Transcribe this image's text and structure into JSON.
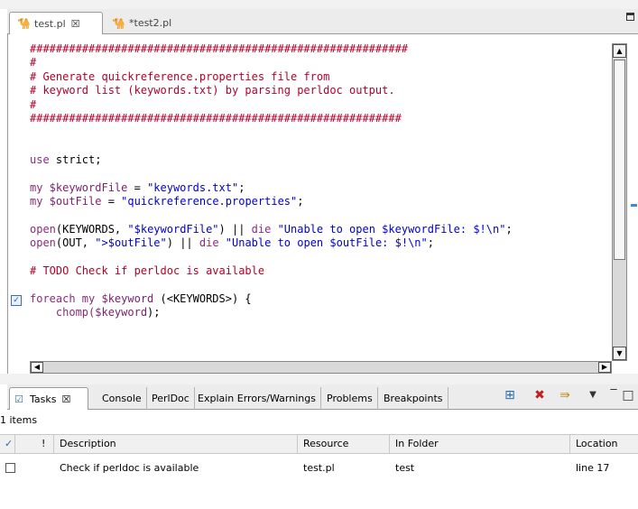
{
  "editor": {
    "tabs": [
      {
        "label": "test.pl",
        "close": "☒",
        "icon": "camel-icon"
      },
      {
        "label": "*test2.pl",
        "icon": "camel-icon"
      }
    ],
    "code_lines": [
      [
        {
          "t": "##########################################################",
          "c": "c-comment"
        }
      ],
      [
        {
          "t": "#",
          "c": "c-comment"
        }
      ],
      [
        {
          "t": "# Generate quickreference.properties file from",
          "c": "c-comment"
        }
      ],
      [
        {
          "t": "# keyword list (keywords.txt) by parsing perldoc output.",
          "c": "c-comment"
        }
      ],
      [
        {
          "t": "#",
          "c": "c-comment"
        }
      ],
      [
        {
          "t": "#########################################################",
          "c": "c-comment"
        }
      ],
      [],
      [],
      [
        {
          "t": "use",
          "c": "c-kw"
        },
        {
          "t": " strict;",
          "c": "c-plain"
        }
      ],
      [],
      [
        {
          "t": "my",
          "c": "c-kw"
        },
        {
          "t": " $keywordFile",
          "c": "c-var"
        },
        {
          "t": " = ",
          "c": "c-plain"
        },
        {
          "t": "\"keywords.txt\"",
          "c": "c-str"
        },
        {
          "t": ";",
          "c": "c-plain"
        }
      ],
      [
        {
          "t": "my",
          "c": "c-kw"
        },
        {
          "t": " $outFile",
          "c": "c-var"
        },
        {
          "t": " = ",
          "c": "c-plain"
        },
        {
          "t": "\"quickreference.properties\"",
          "c": "c-str"
        },
        {
          "t": ";",
          "c": "c-plain"
        }
      ],
      [],
      [
        {
          "t": "open",
          "c": "c-kw"
        },
        {
          "t": "(KEYWORDS, ",
          "c": "c-plain"
        },
        {
          "t": "\"$keywordFile\"",
          "c": "c-str"
        },
        {
          "t": ") || ",
          "c": "c-plain"
        },
        {
          "t": "die",
          "c": "c-kw"
        },
        {
          "t": " \"Unable to open $keywordFile: $!\\n\"",
          "c": "c-str"
        },
        {
          "t": ";",
          "c": "c-plain"
        }
      ],
      [
        {
          "t": "open",
          "c": "c-kw"
        },
        {
          "t": "(OUT, ",
          "c": "c-plain"
        },
        {
          "t": "\">$outFile\"",
          "c": "c-str"
        },
        {
          "t": ") || ",
          "c": "c-plain"
        },
        {
          "t": "die",
          "c": "c-kw"
        },
        {
          "t": " \"Unable to open $outFile: $!\\n\"",
          "c": "c-str"
        },
        {
          "t": ";",
          "c": "c-plain"
        }
      ],
      [],
      [
        {
          "t": "# TODO Check if perldoc is available",
          "c": "c-comment"
        }
      ],
      [],
      [
        {
          "t": "foreach",
          "c": "c-kw"
        },
        {
          "t": " my ",
          "c": "c-kw"
        },
        {
          "t": "$keyword",
          "c": "c-var"
        },
        {
          "t": " (<KEYWORDS>) {",
          "c": "c-plain"
        }
      ],
      [
        {
          "t": "    chomp(",
          "c": "c-kw"
        },
        {
          "t": "$keyword",
          "c": "c-var"
        },
        {
          "t": ");",
          "c": "c-plain"
        }
      ]
    ]
  },
  "views": {
    "tabs": [
      {
        "label": "Tasks",
        "close": "☒",
        "icon": "tasks-icon"
      },
      {
        "label": "Console"
      },
      {
        "label": "PerlDoc"
      },
      {
        "label": "Explain Errors/Warnings"
      },
      {
        "label": "Problems"
      },
      {
        "label": "Breakpoints"
      }
    ],
    "toolbar_icons": [
      "add-task-icon",
      "delete-icon",
      "filter-icon",
      "view-menu-icon"
    ]
  },
  "tasks": {
    "count": "1 items",
    "columns": {
      "check": "✓",
      "priority": "!",
      "description": "Description",
      "resource": "Resource",
      "folder": "In Folder",
      "location": "Location"
    },
    "rows": [
      {
        "description": "Check if perldoc is available",
        "resource": "test.pl",
        "folder": "test",
        "location": "line 17"
      }
    ]
  },
  "colors": {
    "comment": "#b3002a",
    "keyword": "#8a2b7a",
    "string": "#0000c8",
    "accent": "#3a8ad8"
  }
}
